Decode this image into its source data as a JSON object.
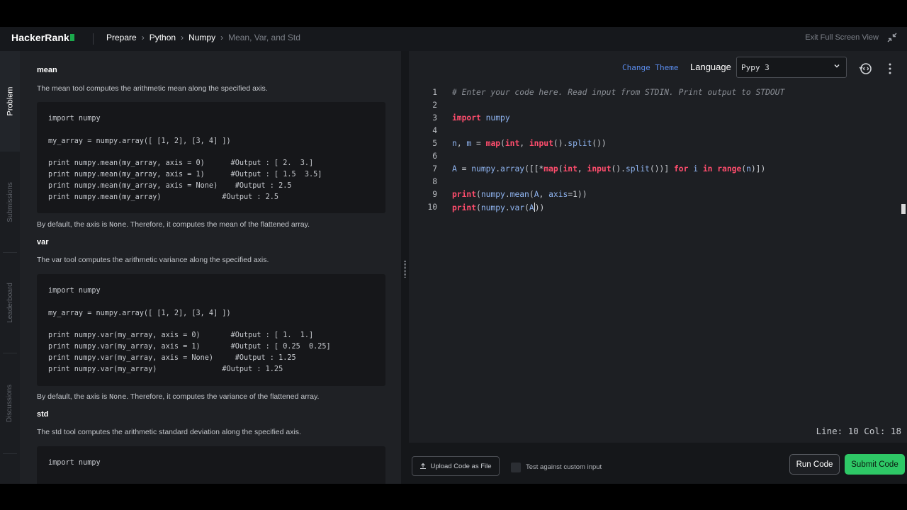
{
  "header": {
    "logo": "HackerRank",
    "breadcrumbs": [
      "Prepare",
      "Python",
      "Numpy",
      "Mean, Var, and Std"
    ],
    "exit_fullscreen": "Exit Full Screen View"
  },
  "rail": {
    "tabs": [
      "Problem",
      "Submissions",
      "Leaderboard",
      "Discussions"
    ],
    "active": "Problem"
  },
  "problem": {
    "sections": [
      {
        "title": "mean",
        "desc": "The mean tool computes the arithmetic mean along the specified axis.",
        "code": "import numpy\n\nmy_array = numpy.array([ [1, 2], [3, 4] ])\n\nprint numpy.mean(my_array, axis = 0)      #Output : [ 2.  3.]\nprint numpy.mean(my_array, axis = 1)      #Output : [ 1.5  3.5]\nprint numpy.mean(my_array, axis = None)    #Output : 2.5\nprint numpy.mean(my_array)              #Output : 2.5",
        "note_pre": "By default, the axis is ",
        "note_code": "None",
        "note_post": ". Therefore, it computes the mean of the flattened array."
      },
      {
        "title": "var",
        "desc": "The var tool computes the arithmetic variance along the specified axis.",
        "code": "import numpy\n\nmy_array = numpy.array([ [1, 2], [3, 4] ])\n\nprint numpy.var(my_array, axis = 0)       #Output : [ 1.  1.]\nprint numpy.var(my_array, axis = 1)       #Output : [ 0.25  0.25]\nprint numpy.var(my_array, axis = None)     #Output : 1.25\nprint numpy.var(my_array)               #Output : 1.25",
        "note_pre": "By default, the axis is ",
        "note_code": "None",
        "note_post": ". Therefore, it computes the variance of the flattened array."
      },
      {
        "title": "std",
        "desc": "The std tool computes the arithmetic standard deviation along the specified axis.",
        "code": "import numpy"
      }
    ]
  },
  "editor": {
    "change_theme": "Change Theme",
    "language_label": "Language",
    "language_value": "Pypy 3",
    "line_numbers": [
      "1",
      "2",
      "3",
      "4",
      "5",
      "6",
      "7",
      "8",
      "9",
      "10"
    ],
    "status": "Line: 10 Col: 18"
  },
  "actions": {
    "upload": "Upload Code as File",
    "custom_input": "Test against custom input",
    "run": "Run Code",
    "submit": "Submit Code"
  }
}
